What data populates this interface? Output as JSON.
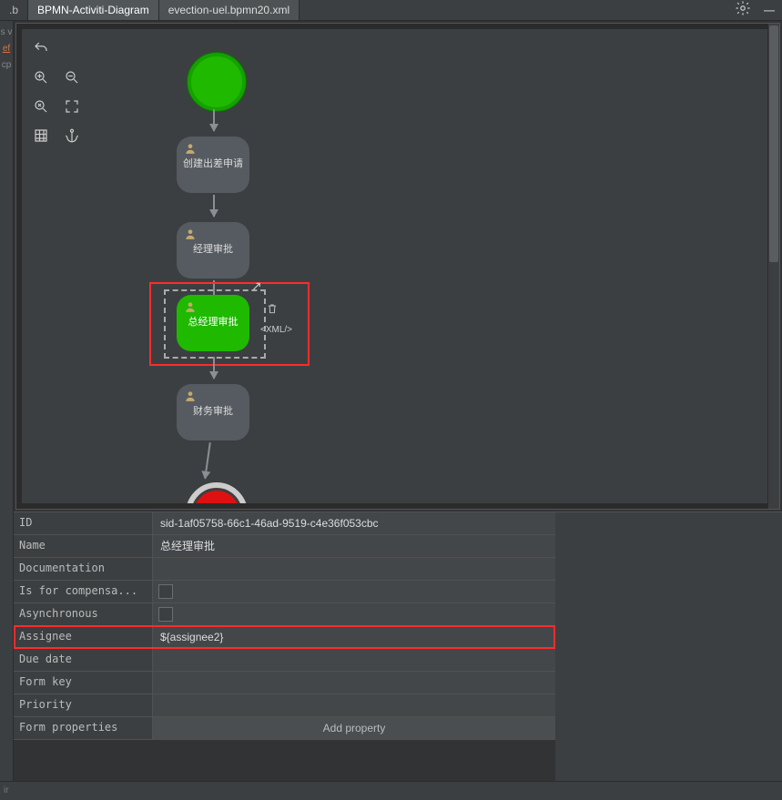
{
  "tabs": {
    "left_fragment": ".b",
    "main": "BPMN-Activiti-Diagram",
    "file": "evection-uel.bpmn20.xml"
  },
  "gutter": {
    "a": "s v",
    "b": "ef",
    "c": "cp"
  },
  "tools": {
    "undo": "undo-icon",
    "zoom_in": "zoom-in-icon",
    "zoom_out": "zoom-out-icon",
    "zoom_fit": "zoom-fit-icon",
    "fullscreen": "fullscreen-icon",
    "grid": "grid-icon",
    "anchor": "anchor-icon"
  },
  "diagram": {
    "task1": "创建出差申请",
    "task2": "经理审批",
    "task3": "总经理审批",
    "task4": "财务审批",
    "xml_label": "<XML/>"
  },
  "props": {
    "rows": {
      "id": {
        "label": "ID",
        "value": "sid-1af05758-66c1-46ad-9519-c4e36f053cbc"
      },
      "name": {
        "label": "Name",
        "value": "总经理审批"
      },
      "doc": {
        "label": "Documentation",
        "value": ""
      },
      "comp": {
        "label": "Is for compensa...",
        "value": ""
      },
      "async": {
        "label": "Asynchronous",
        "value": ""
      },
      "assignee": {
        "label": "Assignee",
        "value": "${assignee2}"
      },
      "due": {
        "label": "Due date",
        "value": ""
      },
      "formkey": {
        "label": "Form key",
        "value": ""
      },
      "priority": {
        "label": "Priority",
        "value": ""
      },
      "formprops": {
        "label": "Form properties",
        "value": "Add property"
      }
    }
  },
  "footer": {
    "left": "ir"
  }
}
